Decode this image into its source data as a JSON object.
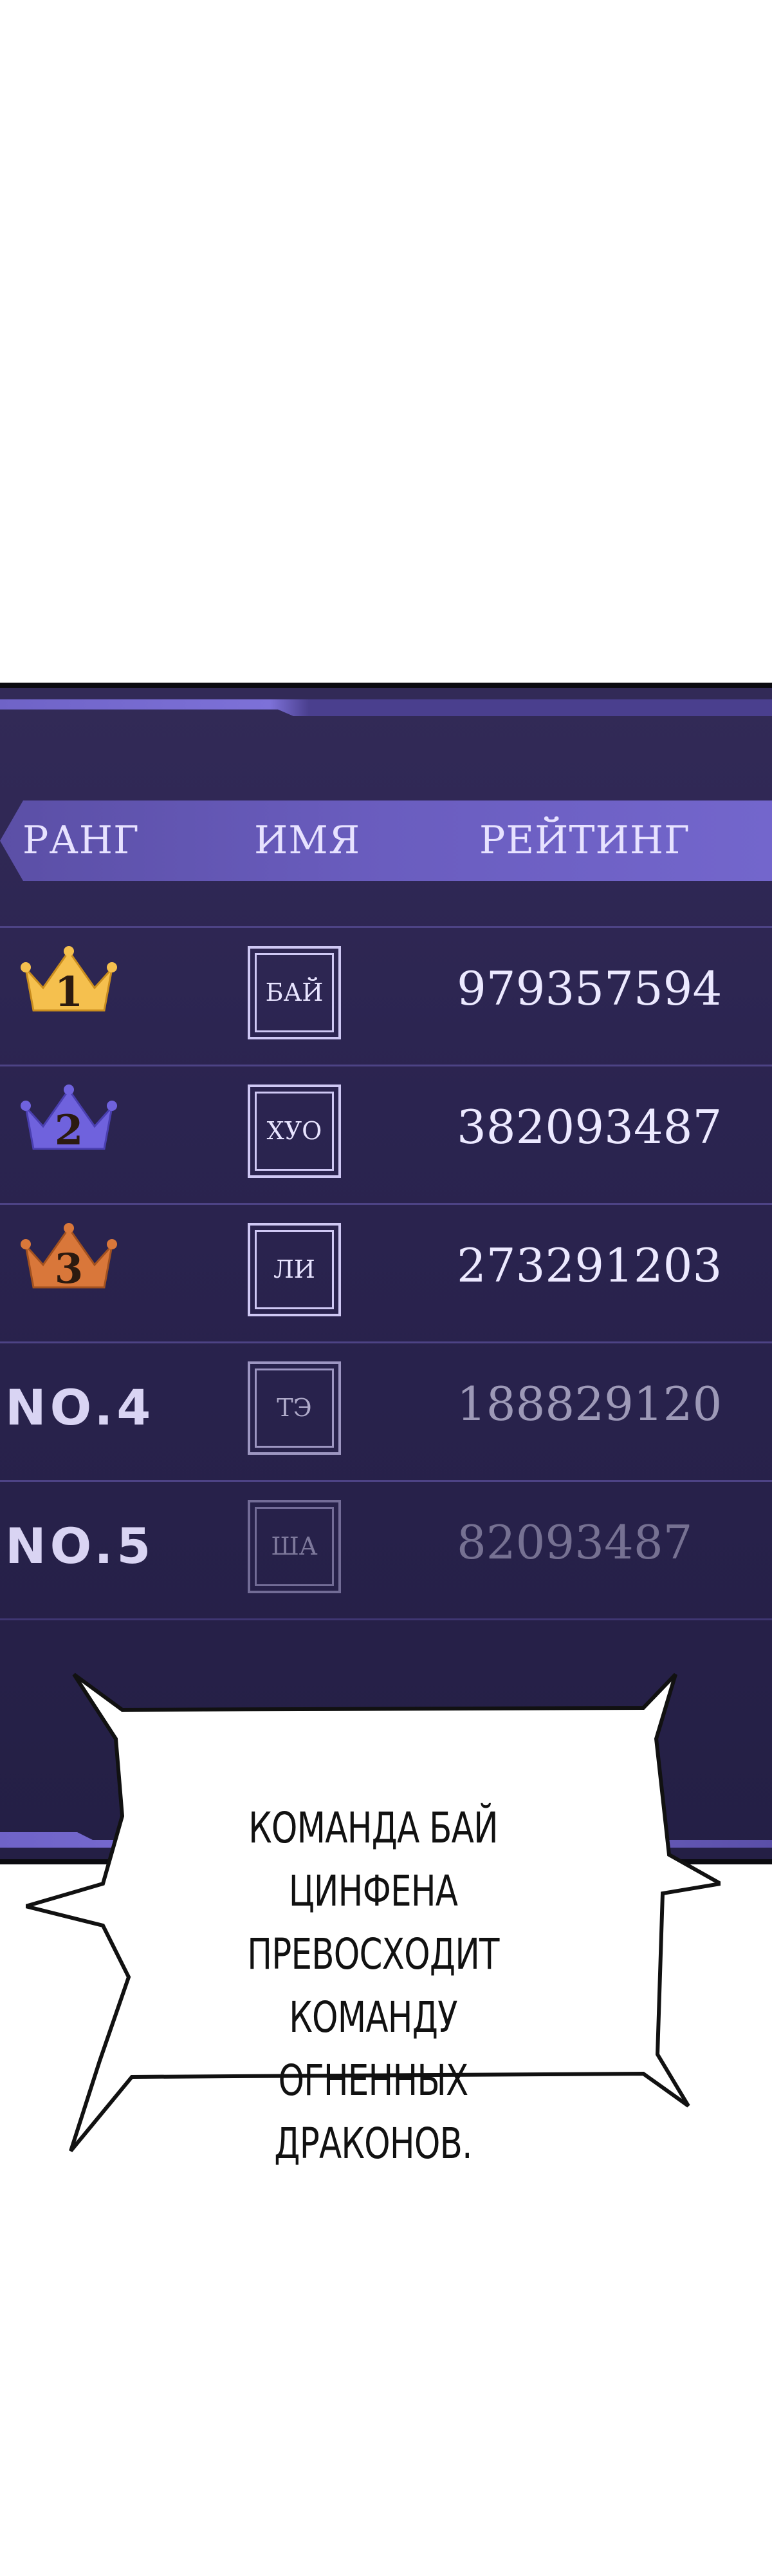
{
  "leaderboard": {
    "headers": {
      "rank": "РАНГ",
      "name": "ИМЯ",
      "rating": "РЕЙТИНГ"
    },
    "rows": [
      {
        "rank": "1",
        "rank_style": "crown-gold",
        "name": "БАЙ",
        "rating": "979357594",
        "color": "#f5c04e"
      },
      {
        "rank": "2",
        "rank_style": "crown-purple",
        "name": "ХУО",
        "rating": "382093487",
        "color": "#6f62dd"
      },
      {
        "rank": "3",
        "rank_style": "crown-orange",
        "name": "ЛИ",
        "rating": "273291203",
        "color": "#d9773a"
      },
      {
        "rank": "NO.4",
        "rank_style": "text",
        "name": "ТЭ",
        "rating": "188829120"
      },
      {
        "rank": "NO.5",
        "rank_style": "text",
        "name": "ША",
        "rating": "82093487"
      }
    ]
  },
  "speech_bubble": {
    "lines": [
      "КОМАНДА БАЙ ЦИНФЕНА",
      "ПРЕВОСХОДИТ КОМАНДУ",
      "ОГНЕННЫХ ДРАКОНОВ."
    ]
  }
}
